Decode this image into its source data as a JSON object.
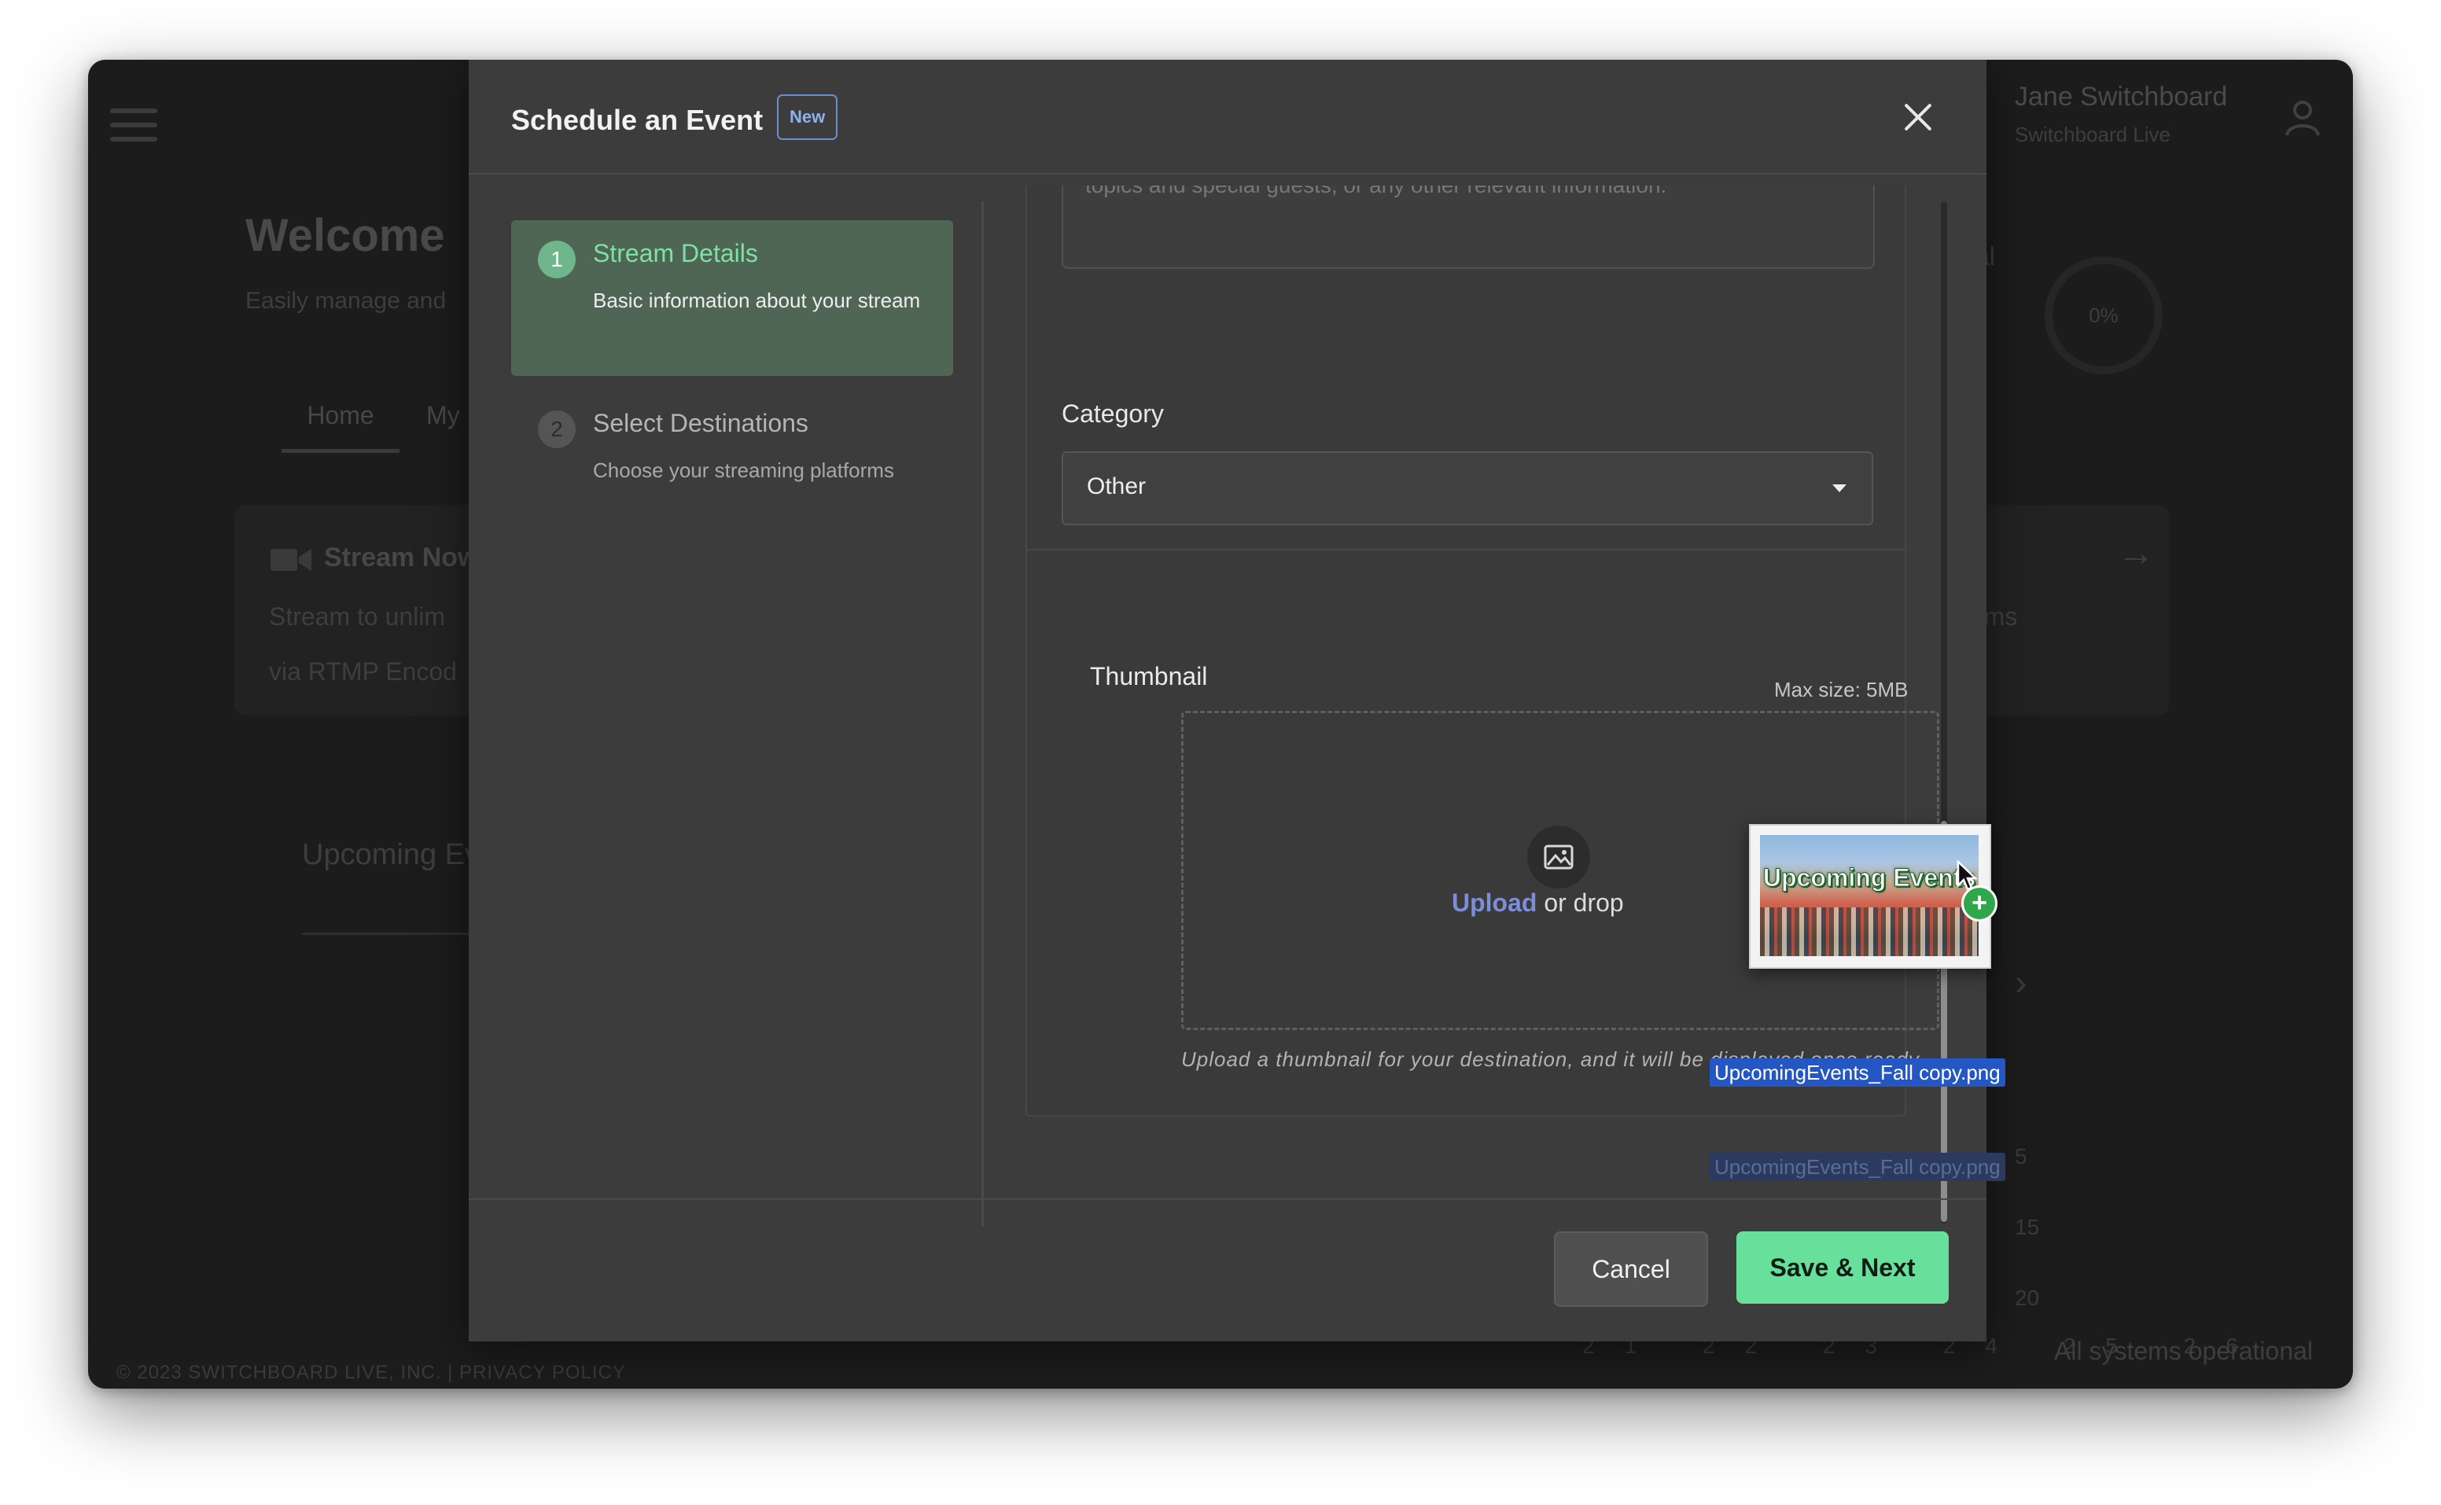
{
  "background": {
    "user_name": "Jane Switchboard",
    "user_subtitle": "Switchboard Live",
    "welcome": "Welcome",
    "welcome_sub": "Easily manage and",
    "tabs": [
      "Home",
      "My"
    ],
    "stream_card": {
      "title": "Stream Now",
      "line1": "Stream to unlim",
      "line2": "via RTMP Encod"
    },
    "upcoming": "Upcoming Events",
    "right_peek1": "al",
    "right_peek2": "rms",
    "percent": "0%",
    "side_nums": [
      "5",
      "15",
      "20"
    ],
    "cal_nums": "21 22 23 24 25 26",
    "footer_left": "© 2023 SWITCHBOARD LIVE, INC. | PRIVACY POLICY",
    "footer_right": "All systems operational"
  },
  "modal": {
    "title": "Schedule an Event",
    "badge": "New",
    "steps": [
      {
        "number": "1",
        "title": "Stream Details",
        "description": "Basic information about your stream"
      },
      {
        "number": "2",
        "title": "Select Destinations",
        "description": "Choose your streaming platforms"
      }
    ],
    "description_fragment": "topics and special guests, or any other relevant information.",
    "category": {
      "label": "Category",
      "selected": "Other"
    },
    "thumbnail": {
      "label": "Thumbnail",
      "max_size": "Max size: 5MB",
      "upload_link": "Upload",
      "upload_rest": " or drop",
      "helper": "Upload a thumbnail for your destination, and it will be displayed once ready."
    },
    "buttons": {
      "cancel": "Cancel",
      "save": "Save & Next"
    }
  },
  "drag": {
    "thumbnail_text": "Upcoming Events",
    "filename": "UpcomingEvents_Fall copy.png",
    "plus": "+"
  },
  "colors": {
    "accent_green": "#66e09a",
    "step_title_green": "#7ee0a4",
    "link_blue": "#7b8ed6",
    "badge_blue": "#8fb0f0",
    "drag_filename_bg": "#2557c4"
  },
  "icons": [
    "hamburger-icon",
    "user-icon",
    "camera-icon",
    "close-icon",
    "chevron-down-icon",
    "image-icon",
    "arrow-right-icon",
    "chevron-right-icon",
    "plus-icon",
    "cursor-icon"
  ]
}
